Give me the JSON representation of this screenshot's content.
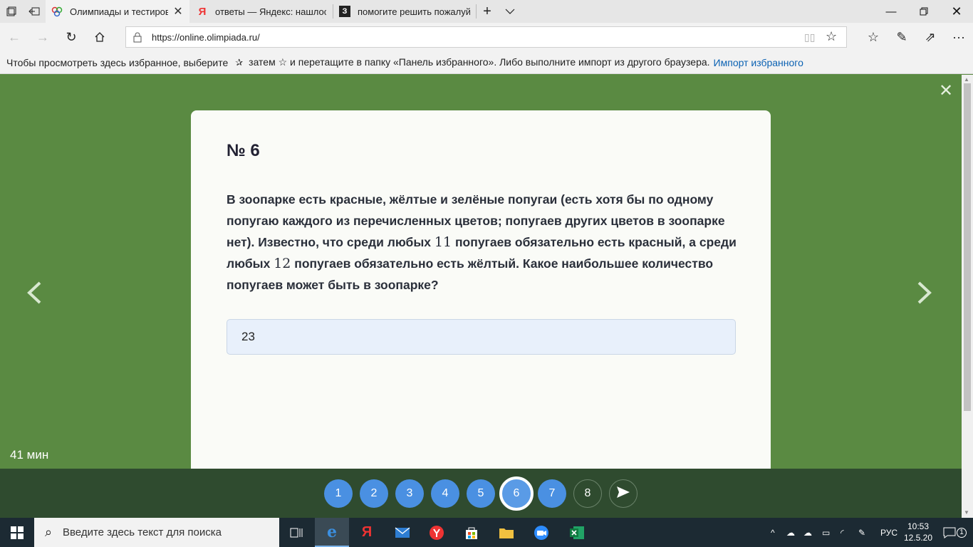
{
  "browser": {
    "tabs": [
      {
        "title": "Олимпиады и тестиров",
        "active": true
      },
      {
        "title": "ответы — Яндекс: нашлось",
        "active": false
      },
      {
        "title": "помогите решить пожалуй",
        "active": false
      }
    ],
    "url": "https://online.olimpiada.ru/",
    "favorites_hint": "Чтобы просмотреть здесь избранное, выберите",
    "favorites_hint_mid": "затем ☆ и перетащите в папку «Панель избранного». Либо выполните импорт из другого браузера.",
    "favorites_import_link": "Импорт избранного"
  },
  "task": {
    "number": "№ 6",
    "text_part1": "В зоопарке есть красные, жёлтые и зелёные попугаи (есть хотя бы по одному попугаю каждого из перечисленных цветов; попугаев других цветов в зоопарке нет). Известно, что среди любых",
    "n1": "11",
    "text_part2": "попугаев обязательно есть красный, а среди любых",
    "n2": "12",
    "text_part3": "попугаев обязательно есть жёлтый. Какое наибольшее количество попугаев может быть в зоопарке?",
    "answer_value": "23"
  },
  "timer": "41 мин",
  "question_nav": [
    {
      "label": "1",
      "state": "answered"
    },
    {
      "label": "2",
      "state": "answered"
    },
    {
      "label": "3",
      "state": "answered"
    },
    {
      "label": "4",
      "state": "answered"
    },
    {
      "label": "5",
      "state": "answered"
    },
    {
      "label": "6",
      "state": "current"
    },
    {
      "label": "7",
      "state": "answered"
    },
    {
      "label": "8",
      "state": "empty"
    }
  ],
  "taskbar": {
    "search_placeholder": "Введите здесь текст для поиска",
    "language": "РУС",
    "time": "10:53",
    "date": "12.5.20",
    "notifications": "1"
  },
  "colors": {
    "page_bg": "#5a8a42",
    "bottom_bar": "#2f4b2f",
    "question_blue": "#4a90e2",
    "answer_bg": "#e8f0fb"
  }
}
